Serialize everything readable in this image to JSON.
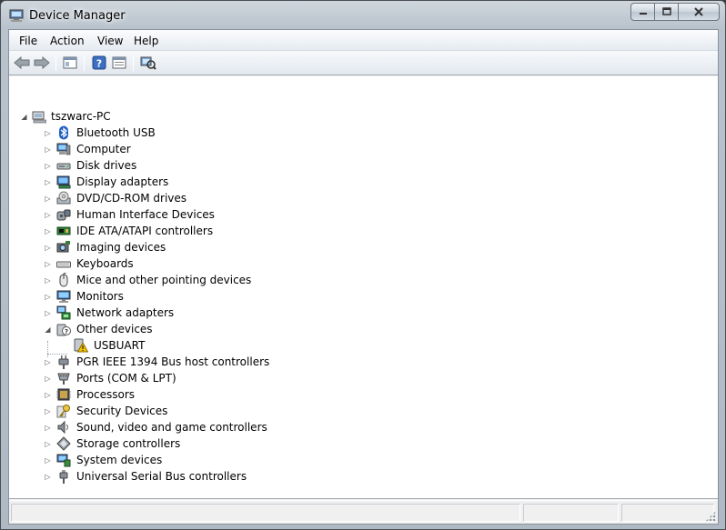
{
  "window": {
    "title": "Device Manager",
    "icon": "device-manager-icon",
    "controls": {
      "minimize": "▁",
      "maximize": "▢",
      "close": "✕"
    }
  },
  "menu": [
    "File",
    "Action",
    "View",
    "Help"
  ],
  "toolbar": {
    "buttons": [
      "back-arrow-icon",
      "forward-arrow-icon",
      "show-hide-console-tree-icon",
      "help-icon",
      "properties-icon",
      "scan-hardware-changes-icon"
    ]
  },
  "tree": {
    "root": {
      "label": "tszwarc-PC",
      "icon": "computer-icon",
      "expanded": true
    },
    "categories": [
      {
        "label": "Bluetooth USB",
        "icon": "bluetooth-icon",
        "expanded": false
      },
      {
        "label": "Computer",
        "icon": "computer-icon",
        "expanded": false
      },
      {
        "label": "Disk drives",
        "icon": "disk-drive-icon",
        "expanded": false
      },
      {
        "label": "Display adapters",
        "icon": "display-adapter-icon",
        "expanded": false
      },
      {
        "label": "DVD/CD-ROM drives",
        "icon": "dvd-drive-icon",
        "expanded": false
      },
      {
        "label": "Human Interface Devices",
        "icon": "hid-icon",
        "expanded": false
      },
      {
        "label": "IDE ATA/ATAPI controllers",
        "icon": "ide-controller-icon",
        "expanded": false
      },
      {
        "label": "Imaging devices",
        "icon": "camera-icon",
        "expanded": false
      },
      {
        "label": "Keyboards",
        "icon": "keyboard-icon",
        "expanded": false
      },
      {
        "label": "Mice and other pointing devices",
        "icon": "mouse-icon",
        "expanded": false
      },
      {
        "label": "Monitors",
        "icon": "monitor-icon",
        "expanded": false
      },
      {
        "label": "Network adapters",
        "icon": "network-adapter-icon",
        "expanded": false
      },
      {
        "label": "Other devices",
        "icon": "unknown-device-icon",
        "expanded": true,
        "children": [
          {
            "label": "USBUART",
            "icon": "warning-device-icon"
          }
        ]
      },
      {
        "label": "PGR IEEE 1394 Bus host controllers",
        "icon": "plug-icon",
        "expanded": false
      },
      {
        "label": "Ports (COM & LPT)",
        "icon": "port-icon",
        "expanded": false
      },
      {
        "label": "Processors",
        "icon": "processor-icon",
        "expanded": false
      },
      {
        "label": "Security Devices",
        "icon": "key-icon",
        "expanded": false
      },
      {
        "label": "Sound, video and game controllers",
        "icon": "speaker-icon",
        "expanded": false
      },
      {
        "label": "Storage controllers",
        "icon": "storage-controller-icon",
        "expanded": false
      },
      {
        "label": "System devices",
        "icon": "system-device-icon",
        "expanded": false
      },
      {
        "label": "Universal Serial Bus controllers",
        "icon": "usb-icon",
        "expanded": false
      }
    ]
  },
  "colors": {
    "selection": "#3399ff",
    "warning": "#f2c200"
  }
}
